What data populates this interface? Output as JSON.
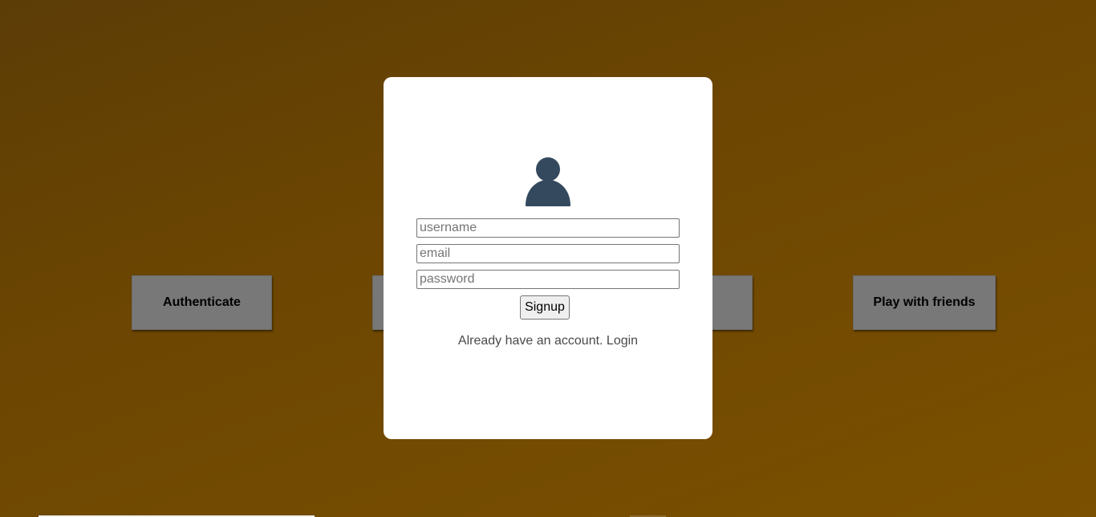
{
  "background_buttons": {
    "authenticate_label": "Authenticate",
    "play_with_friends_label": "Play with friends"
  },
  "signup_modal": {
    "avatar_icon": "user-icon",
    "avatar_color": "#34495e",
    "username_placeholder": "username",
    "email_placeholder": "email",
    "password_placeholder": "password",
    "username_value": "",
    "email_value": "",
    "password_value": "",
    "signup_button_label": "Signup",
    "login_link_text": "Already have an account. Login"
  },
  "colors": {
    "background_gradient_start": "#5c3d06",
    "background_gradient_end": "#7b5000",
    "button_bg": "#787878",
    "modal_bg": "#ffffff"
  }
}
